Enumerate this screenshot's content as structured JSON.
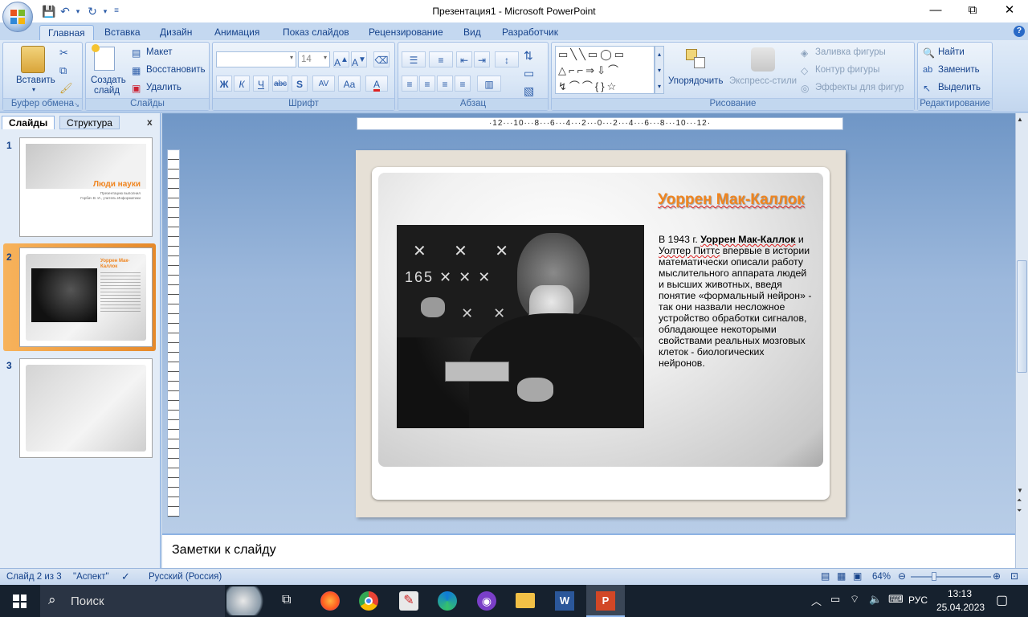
{
  "window": {
    "title": "Презентация1 - Microsoft PowerPoint",
    "minimize": "—",
    "maximize": "⧉",
    "close": "✕"
  },
  "tabs": [
    "Главная",
    "Вставка",
    "Дизайн",
    "Анимация",
    "Показ слайдов",
    "Рецензирование",
    "Вид",
    "Разработчик"
  ],
  "ribbon": {
    "clipboard": {
      "label": "Буфер обмена",
      "paste": "Вставить"
    },
    "slides": {
      "label": "Слайды",
      "create": "Создать",
      "create2": "слайд",
      "layout": "Макет",
      "reset": "Восстановить",
      "delete": "Удалить"
    },
    "font": {
      "label": "Шрифт",
      "size": "14",
      "bold": "Ж",
      "italic": "К",
      "underline": "Ч",
      "strike": "abc",
      "shadow": "S",
      "spacing": "AV",
      "case": "Aa",
      "color": "A"
    },
    "paragraph": {
      "label": "Абзац"
    },
    "drawing": {
      "label": "Рисование",
      "arrange": "Упорядочить",
      "quickstyles": "Экспресс-стили",
      "fill": "Заливка фигуры",
      "outline": "Контур фигуры",
      "effects": "Эффекты для фигур"
    },
    "editing": {
      "label": "Редактирование",
      "find": "Найти",
      "replace": "Заменить",
      "select": "Выделить"
    }
  },
  "panel": {
    "tab_slides": "Слайды",
    "tab_outline": "Структура",
    "close": "x"
  },
  "thumbs": [
    {
      "num": "1",
      "title": "Люди науки",
      "sub1": "Презентацию выполнил",
      "sub2": "Горбач В. И., учитель Информатики"
    },
    {
      "num": "2",
      "title": "Уоррен Мак-Каллок"
    },
    {
      "num": "3"
    }
  ],
  "ruler": {
    "h": "·12···10···8···6···4···2···0···2···4···6···8···10···12·"
  },
  "slide": {
    "title": "Уоррен Мак-Каллок",
    "body_pre": "В 1943 г. ",
    "body_bold": "Уоррен Мак-Каллок",
    "body_mid": " и ",
    "body_name2": "Уолтер Питтс",
    "body_post": " впервые в истории математически описали работу мыслительного аппарата людей и высших животных, введя понятие «формальный нейрон» - так они назвали несложное устройство обработки сигналов, обладающее некоторыми свойствами реальных мозговых клеток - биологических нейронов."
  },
  "notes": {
    "placeholder": "Заметки к слайду"
  },
  "status": {
    "slide": "Слайд 2 из 3",
    "theme": "\"Аспект\"",
    "lang": "Русский (Россия)",
    "zoom": "64%"
  },
  "taskbar": {
    "search": "Поиск",
    "lang": "РУС",
    "time": "13:13",
    "date": "25.04.2023"
  },
  "colors": {
    "accent": "#f0851f",
    "ribbon": "#dfeaf7",
    "taskbar": "#16212e"
  }
}
